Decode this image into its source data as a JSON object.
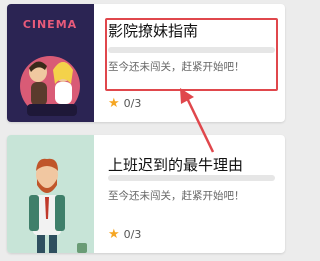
{
  "cards": [
    {
      "thumb_text": "CINEMA",
      "title": "影院撩妹指南",
      "progress": 0,
      "subtitle": "至今还未闯关，赶紧开始吧！",
      "rating": "0/3",
      "thumb_icon": "cinema-couple-illustration"
    },
    {
      "title": "上班迟到的最牛理由",
      "progress": 0,
      "subtitle": "至今还未闯关，赶紧开始吧！",
      "rating": "0/3",
      "thumb_icon": "bearded-man-illustration"
    }
  ],
  "colors": {
    "accent": "#f5a623",
    "highlight": "#e0474c",
    "card1_bg": "#2b2453",
    "card2_bg": "#cfe9dd"
  }
}
